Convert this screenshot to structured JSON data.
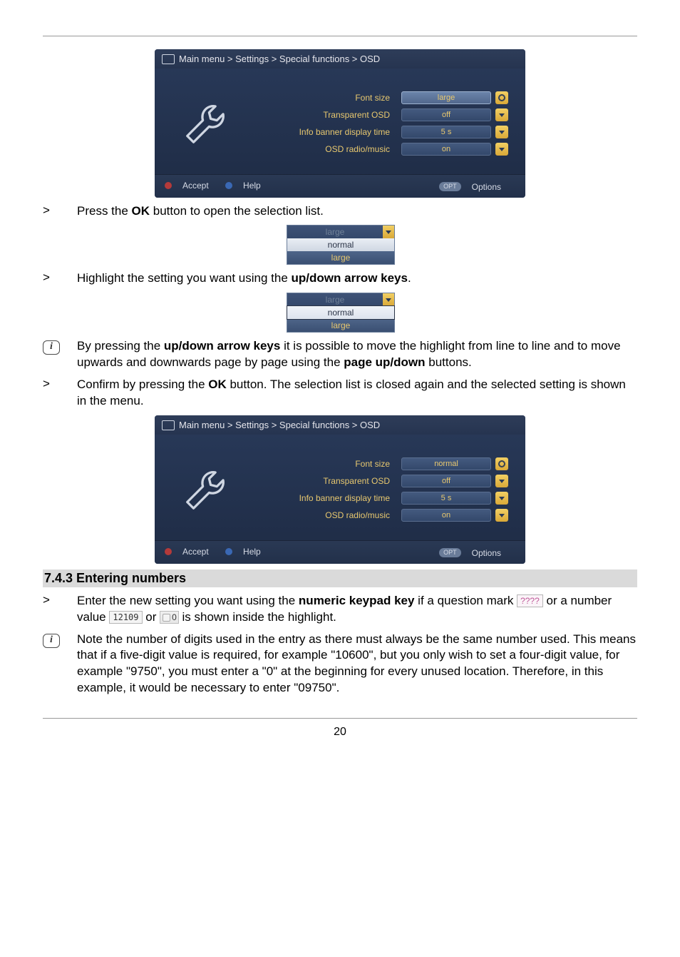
{
  "osd": {
    "breadcrumb": "Main menu > Settings > Special functions > OSD",
    "rows": {
      "font_label": "Font size",
      "transp_label": "Transparent OSD",
      "banner_label": "Info banner display time",
      "radio_label": "OSD radio/music",
      "val_large": "large",
      "val_normal": "normal",
      "val_off": "off",
      "val_5s": "5 s",
      "val_on": "on"
    },
    "footer": {
      "accept": "Accept",
      "help": "Help",
      "options": "Options",
      "opt_pill": "OPT"
    }
  },
  "dd": {
    "head": "large",
    "normal": "normal",
    "large": "large"
  },
  "steps": {
    "s1_a": "Press the ",
    "s1_b": "OK",
    "s1_c": " button to open the selection list.",
    "s2_a": "Highlight the setting you want using the ",
    "s2_b": "up/down arrow keys",
    "s2_c": ".",
    "i1_a": "By pressing the ",
    "i1_b": "up/down arrow keys",
    "i1_c": " it is possible to move the highlight from line to line and to move upwards and downwards page by page using the ",
    "i1_d": "page up/down",
    "i1_e": " buttons.",
    "s3_a": "Confirm by pressing the ",
    "s3_b": "OK",
    "s3_c": " button. The selection list is closed again and the selected setting is shown in the menu.",
    "s4_a": "Enter the new setting you want using the ",
    "s4_b": "numeric keypad key",
    "s4_c": " if a question mark ",
    "s4_d": " or a number value ",
    "s4_e": " or ",
    "s4_f": " is shown inside the highlight.",
    "i2": "Note the number of digits used in the entry as there must always be the same number used. This means that if a five-digit value is required, for example \"10600\", but you only wish to set a four-digit value, for example \"9750\", you must enter a \"0\" at the beginning for every unused location. Therefore, in this example, it would be necessary to enter \"09750\"."
  },
  "badges": {
    "qmark": "????",
    "num": "12109",
    "zero": "0"
  },
  "glyphs": {
    "gt": ">",
    "i": "i"
  },
  "section": "7.4.3 Entering numbers",
  "page_number": "20"
}
